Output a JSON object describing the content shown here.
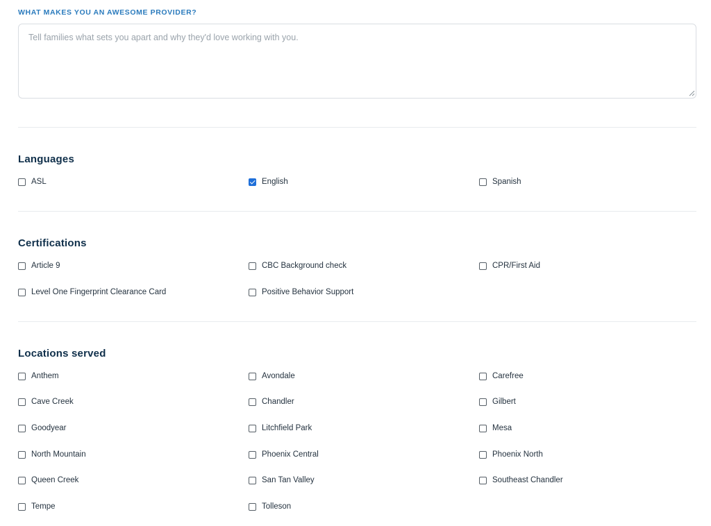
{
  "about": {
    "label": "WHAT MAKES YOU AN AWESOME PROVIDER?",
    "value": "",
    "placeholder": "Tell families what sets you apart and why they'd love working with you."
  },
  "languages": {
    "title": "Languages",
    "options": [
      {
        "label": "ASL",
        "checked": false
      },
      {
        "label": "English",
        "checked": true
      },
      {
        "label": "Spanish",
        "checked": false
      }
    ]
  },
  "certifications": {
    "title": "Certifications",
    "options": [
      {
        "label": "Article 9",
        "checked": false
      },
      {
        "label": "CBC Background check",
        "checked": false
      },
      {
        "label": "CPR/First Aid",
        "checked": false
      },
      {
        "label": "Level One Fingerprint Clearance Card",
        "checked": false
      },
      {
        "label": "Positive Behavior Support",
        "checked": false
      }
    ]
  },
  "locations": {
    "title": "Locations served",
    "options": [
      {
        "label": "Anthem",
        "checked": false
      },
      {
        "label": "Avondale",
        "checked": false
      },
      {
        "label": "Carefree",
        "checked": false
      },
      {
        "label": "Cave Creek",
        "checked": false
      },
      {
        "label": "Chandler",
        "checked": false
      },
      {
        "label": "Gilbert",
        "checked": false
      },
      {
        "label": "Goodyear",
        "checked": false
      },
      {
        "label": "Litchfield Park",
        "checked": false
      },
      {
        "label": "Mesa",
        "checked": false
      },
      {
        "label": "North Mountain",
        "checked": false
      },
      {
        "label": "Phoenix Central",
        "checked": false
      },
      {
        "label": "Phoenix North",
        "checked": false
      },
      {
        "label": "Queen Creek",
        "checked": false
      },
      {
        "label": "San Tan Valley",
        "checked": false
      },
      {
        "label": "Southeast Chandler",
        "checked": false
      },
      {
        "label": "Tempe",
        "checked": false
      },
      {
        "label": "Tolleson",
        "checked": false
      }
    ]
  },
  "colors": {
    "label_accent": "#2b7bbd",
    "heading": "#0f2f4a",
    "checkbox_checked": "#1e6fd9"
  }
}
